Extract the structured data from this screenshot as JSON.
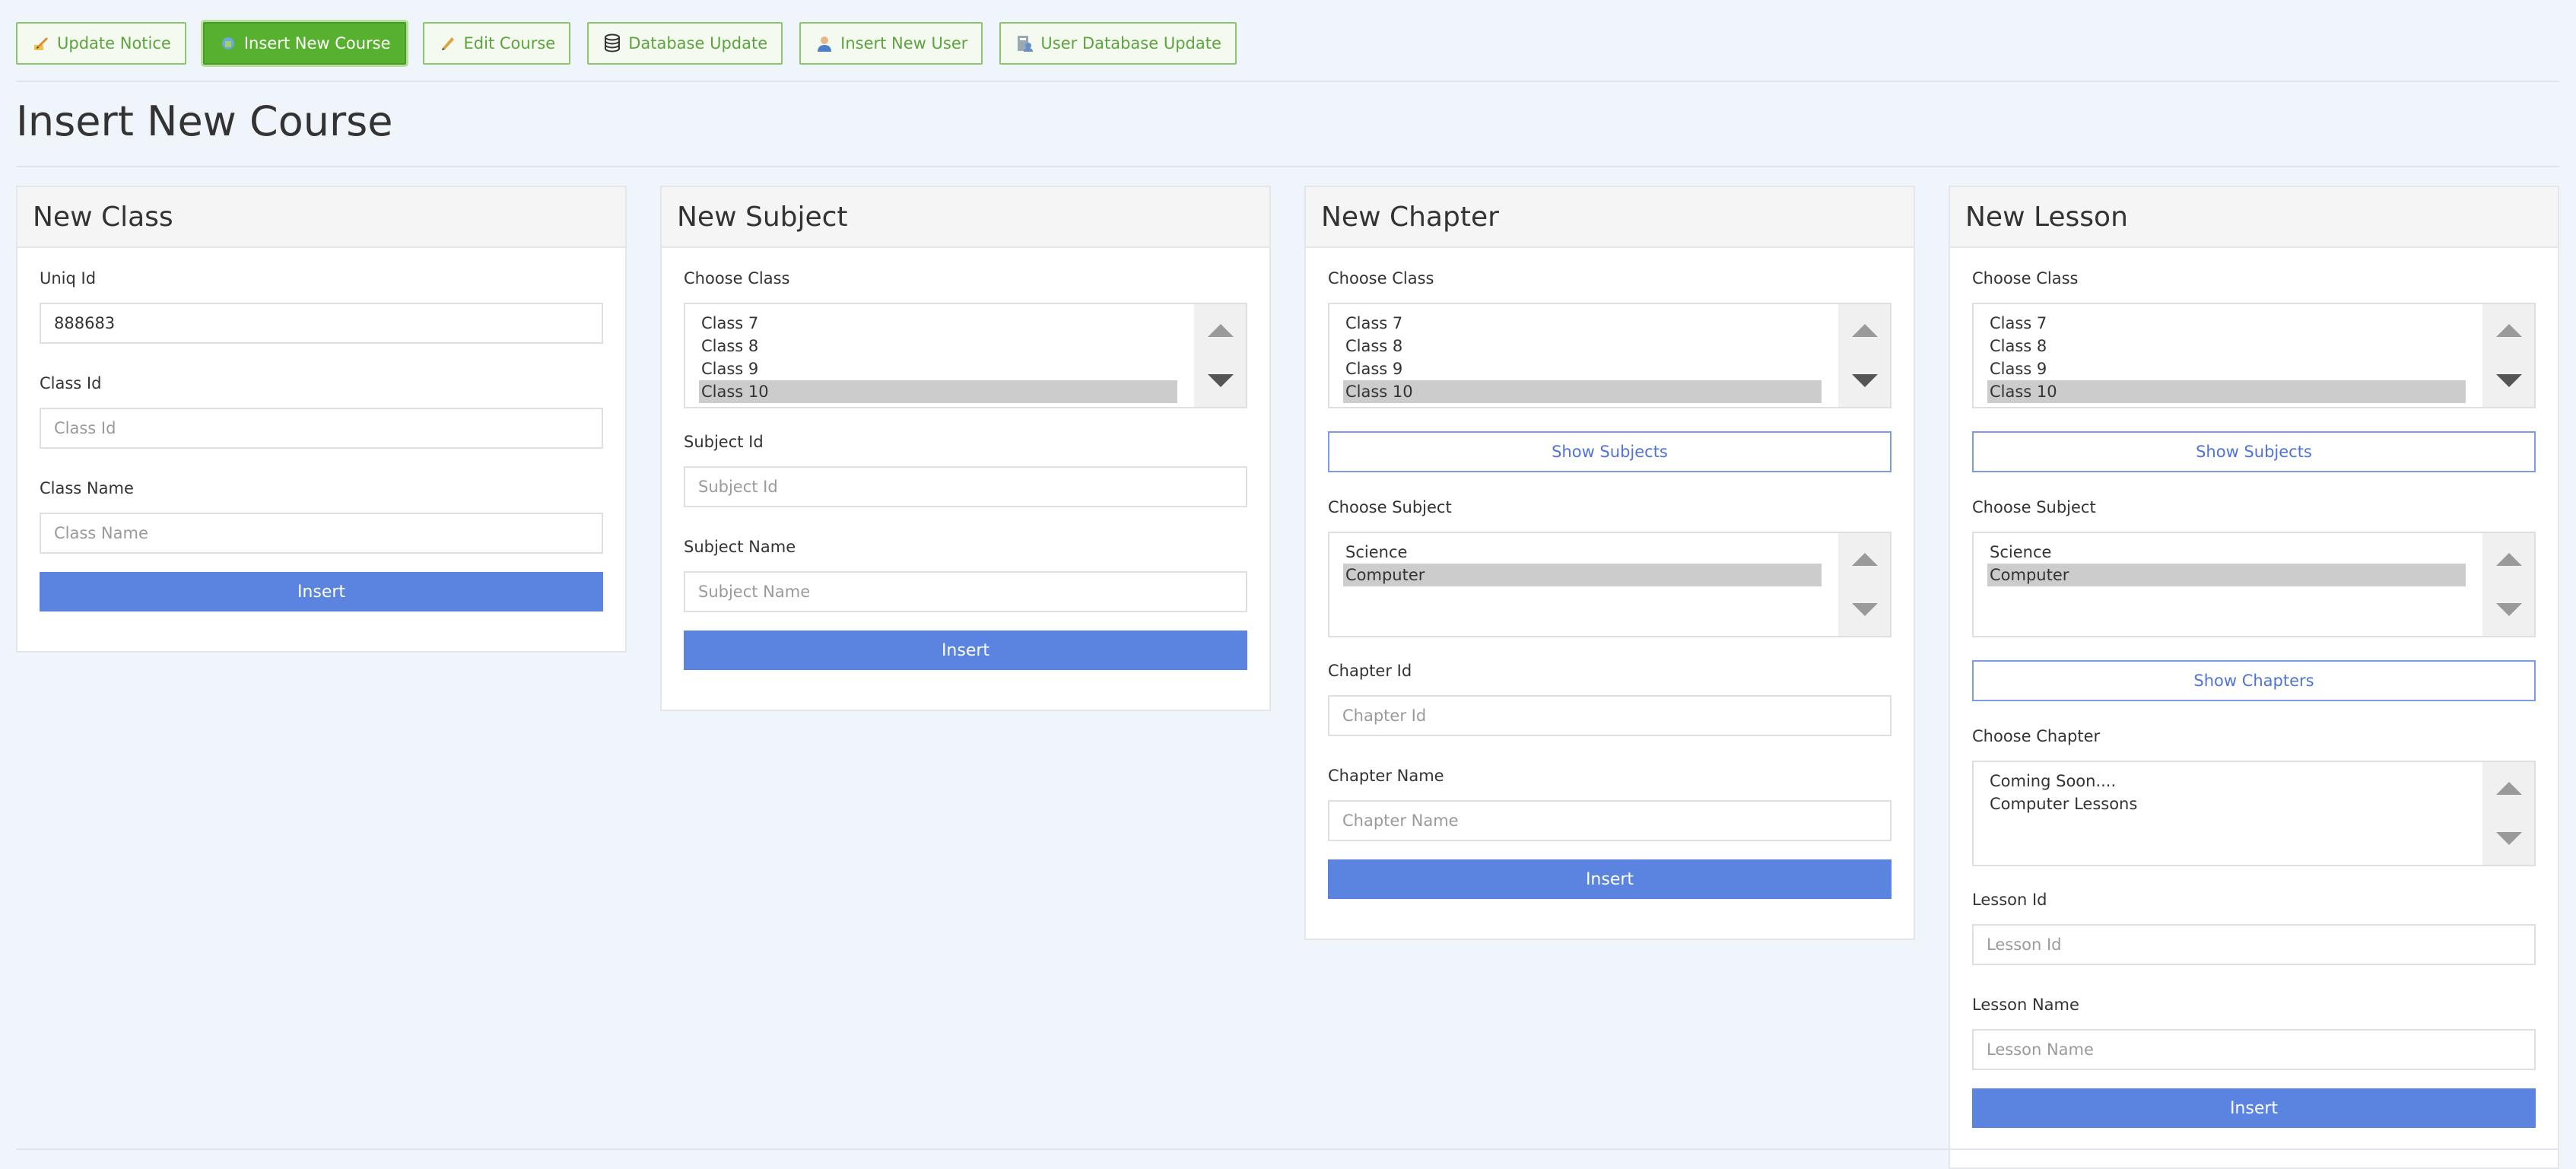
{
  "nav": [
    {
      "label": "Update Notice",
      "icon": "pencil-note-icon",
      "active": false
    },
    {
      "label": "Insert New Course",
      "icon": "course-icon",
      "active": true
    },
    {
      "label": "Edit Course",
      "icon": "pencil-icon",
      "active": false
    },
    {
      "label": "Database Update",
      "icon": "database-icon",
      "active": false
    },
    {
      "label": "Insert New User",
      "icon": "user-icon",
      "active": false
    },
    {
      "label": "User Database Update",
      "icon": "user-database-icon",
      "active": false
    }
  ],
  "page_title": "Insert New Course",
  "colors": {
    "accent": "#5a84e0",
    "nav_green": "#57b12f",
    "background": "#f0f5fc"
  },
  "new_class": {
    "title": "New Class",
    "uniq_id_label": "Uniq Id",
    "uniq_id_value": "888683",
    "class_id_label": "Class Id",
    "class_id_placeholder": "Class Id",
    "class_name_label": "Class Name",
    "class_name_placeholder": "Class Name",
    "insert": "Insert"
  },
  "new_subject": {
    "title": "New Subject",
    "choose_class_label": "Choose Class",
    "classes": [
      "Class 7",
      "Class 8",
      "Class 9",
      "Class 10"
    ],
    "subject_id_label": "Subject Id",
    "subject_id_placeholder": "Subject Id",
    "subject_name_label": "Subject Name",
    "subject_name_placeholder": "Subject Name",
    "insert": "Insert"
  },
  "new_chapter": {
    "title": "New Chapter",
    "choose_class_label": "Choose Class",
    "classes": [
      "Class 7",
      "Class 8",
      "Class 9",
      "Class 10"
    ],
    "show_subjects": "Show Subjects",
    "choose_subject_label": "Choose Subject",
    "subjects": [
      "Science",
      "Computer"
    ],
    "chapter_id_label": "Chapter Id",
    "chapter_id_placeholder": "Chapter Id",
    "chapter_name_label": "Chapter Name",
    "chapter_name_placeholder": "Chapter Name",
    "insert": "Insert"
  },
  "new_lesson": {
    "title": "New Lesson",
    "choose_class_label": "Choose Class",
    "classes": [
      "Class 7",
      "Class 8",
      "Class 9",
      "Class 10"
    ],
    "show_subjects": "Show Subjects",
    "choose_subject_label": "Choose Subject",
    "subjects": [
      "Science",
      "Computer"
    ],
    "show_chapters": "Show Chapters",
    "choose_chapter_label": "Choose Chapter",
    "chapters": [
      "Coming Soon....",
      "Computer Lessons"
    ],
    "lesson_id_label": "Lesson Id",
    "lesson_id_placeholder": "Lesson Id",
    "lesson_name_label": "Lesson Name",
    "lesson_name_placeholder": "Lesson Name",
    "insert": "Insert"
  }
}
